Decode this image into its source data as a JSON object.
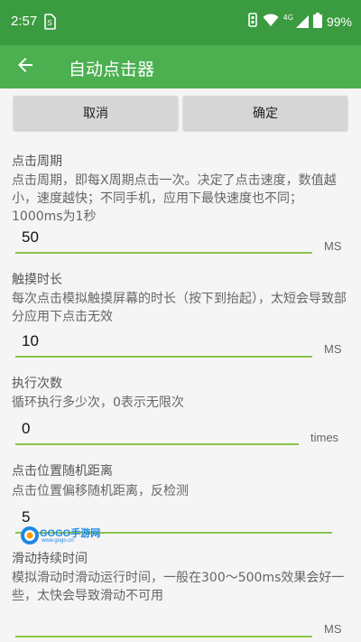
{
  "status_bar": {
    "time": "2:57",
    "network": "4G",
    "battery": "99%",
    "icons": [
      "sim-icon",
      "wifi-icon",
      "signal-icon",
      "battery-icon"
    ]
  },
  "app_bar": {
    "title": "自动点击器",
    "back_icon": "arrow-left-icon"
  },
  "buttons": {
    "cancel": "取消",
    "confirm": "确定"
  },
  "settings": [
    {
      "title": "点击周期",
      "description": "点击周期，即每X周期点击一次。决定了点击速度，数值越小，速度越快；不同手机，应用下最快速度也不同；1000ms为1秒",
      "value": "50",
      "unit": "MS"
    },
    {
      "title": "触摸时长",
      "description": "每次点击模拟触摸屏幕的时长（按下到抬起），太短会导致部分应用下点击无效",
      "value": "10",
      "unit": "MS"
    },
    {
      "title": "执行次数",
      "description": "循环执行多少次，0表示无限次",
      "value": "0",
      "unit": "times"
    },
    {
      "title": "点击位置随机距离",
      "description": "点击位置偏移随机距离，反检测",
      "value": "5",
      "unit": ""
    },
    {
      "title": "滑动持续时间",
      "description": "模拟滑动时滑动运行时间，一般在300～500ms效果会好一些，太快会导致滑动不可用",
      "value": "",
      "unit": "MS"
    }
  ],
  "watermark": {
    "text": "GOGO手游网",
    "subtext": "www.gogo.cn"
  },
  "colors": {
    "status_bar": "#3b9b40",
    "app_bar": "#4caf50",
    "input_underline": "#8bc34a",
    "button_bg": "#d6d6d6"
  }
}
